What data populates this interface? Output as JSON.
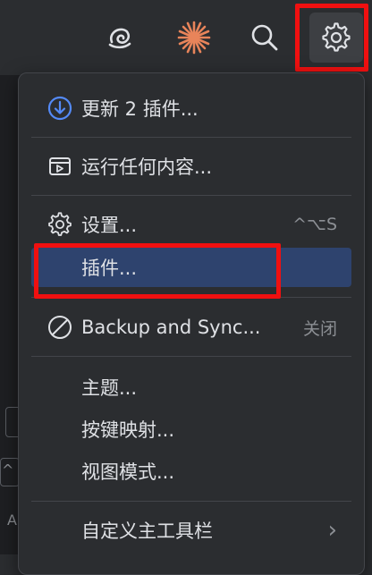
{
  "toolbar": {
    "icons": [
      "copilot-spiral-icon",
      "ai-assistant-sparkle-icon",
      "search-icon",
      "gear-icon"
    ]
  },
  "background": {
    "fragment_a": "A",
    "fragment_b": "^"
  },
  "menu": {
    "items": [
      {
        "label": "更新 2 插件...",
        "icon": "download-circle-icon"
      },
      {
        "label": "运行任何内容...",
        "icon": "run-anything-icon"
      },
      {
        "label": "设置...",
        "icon": "gear-icon",
        "shortcut": "^⌥S"
      },
      {
        "label": "插件...",
        "selected": true
      },
      {
        "label": "Backup and Sync...",
        "icon": "disabled-circle-icon",
        "status": "关闭"
      },
      {
        "label": "主题..."
      },
      {
        "label": "按键映射..."
      },
      {
        "label": "视图模式..."
      },
      {
        "label": "自定义主工具栏",
        "submenu_arrow": "›"
      }
    ]
  },
  "colors": {
    "accent_blue": "#548af7",
    "selected_bg": "#2e436e",
    "highlight_red": "#f01010",
    "sparkle_orange": "#e8845a"
  }
}
